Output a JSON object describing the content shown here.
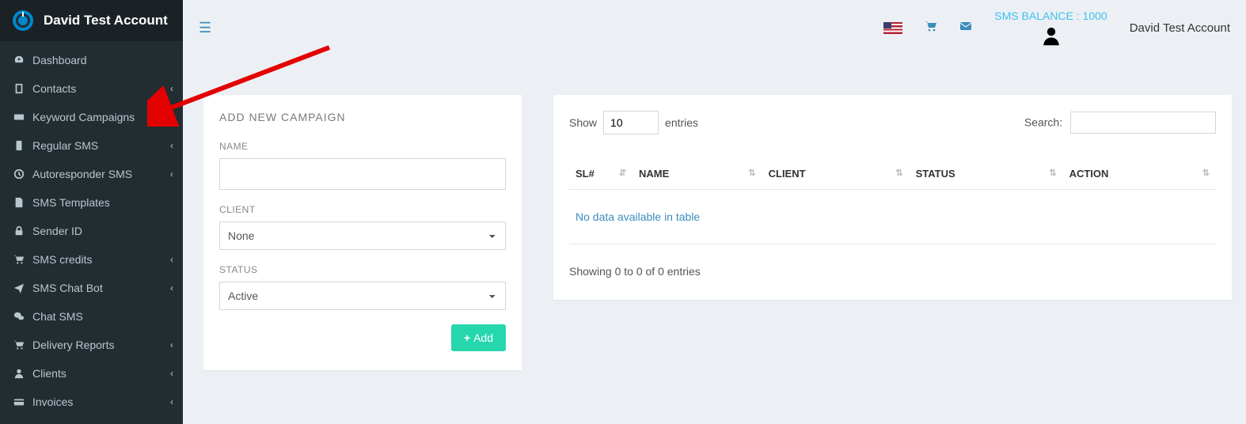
{
  "brand": {
    "name": "David Test Account"
  },
  "sidebar": {
    "items": [
      {
        "label": "Dashboard",
        "icon": "gauge",
        "expandable": false
      },
      {
        "label": "Contacts",
        "icon": "book",
        "expandable": true
      },
      {
        "label": "Keyword Campaigns",
        "icon": "keyboard",
        "expandable": true
      },
      {
        "label": "Regular SMS",
        "icon": "mobile",
        "expandable": true
      },
      {
        "label": "Autoresponder SMS",
        "icon": "clock",
        "expandable": true
      },
      {
        "label": "SMS Templates",
        "icon": "filecode",
        "expandable": false
      },
      {
        "label": "Sender ID",
        "icon": "lock",
        "expandable": false
      },
      {
        "label": "SMS credits",
        "icon": "cart",
        "expandable": true
      },
      {
        "label": "SMS Chat Bot",
        "icon": "plane",
        "expandable": true
      },
      {
        "label": "Chat SMS",
        "icon": "comments",
        "expandable": false
      },
      {
        "label": "Delivery Reports",
        "icon": "cart",
        "expandable": true
      },
      {
        "label": "Clients",
        "icon": "user",
        "expandable": true
      },
      {
        "label": "Invoices",
        "icon": "card",
        "expandable": true
      }
    ]
  },
  "topbar": {
    "balance": "SMS BALANCE : 1000",
    "username": "David Test Account"
  },
  "form": {
    "title": "ADD NEW CAMPAIGN",
    "name_label": "NAME",
    "name_value": "",
    "client_label": "CLIENT",
    "client_value": "None",
    "status_label": "STATUS",
    "status_value": "Active",
    "add_label": "Add"
  },
  "table": {
    "show_prefix": "Show",
    "show_value": "10",
    "show_suffix": "entries",
    "search_label": "Search:",
    "search_value": "",
    "columns": [
      "SL#",
      "NAME",
      "CLIENT",
      "STATUS",
      "ACTION"
    ],
    "empty_message": "No data available in table",
    "info": "Showing 0 to 0 of 0 entries"
  }
}
